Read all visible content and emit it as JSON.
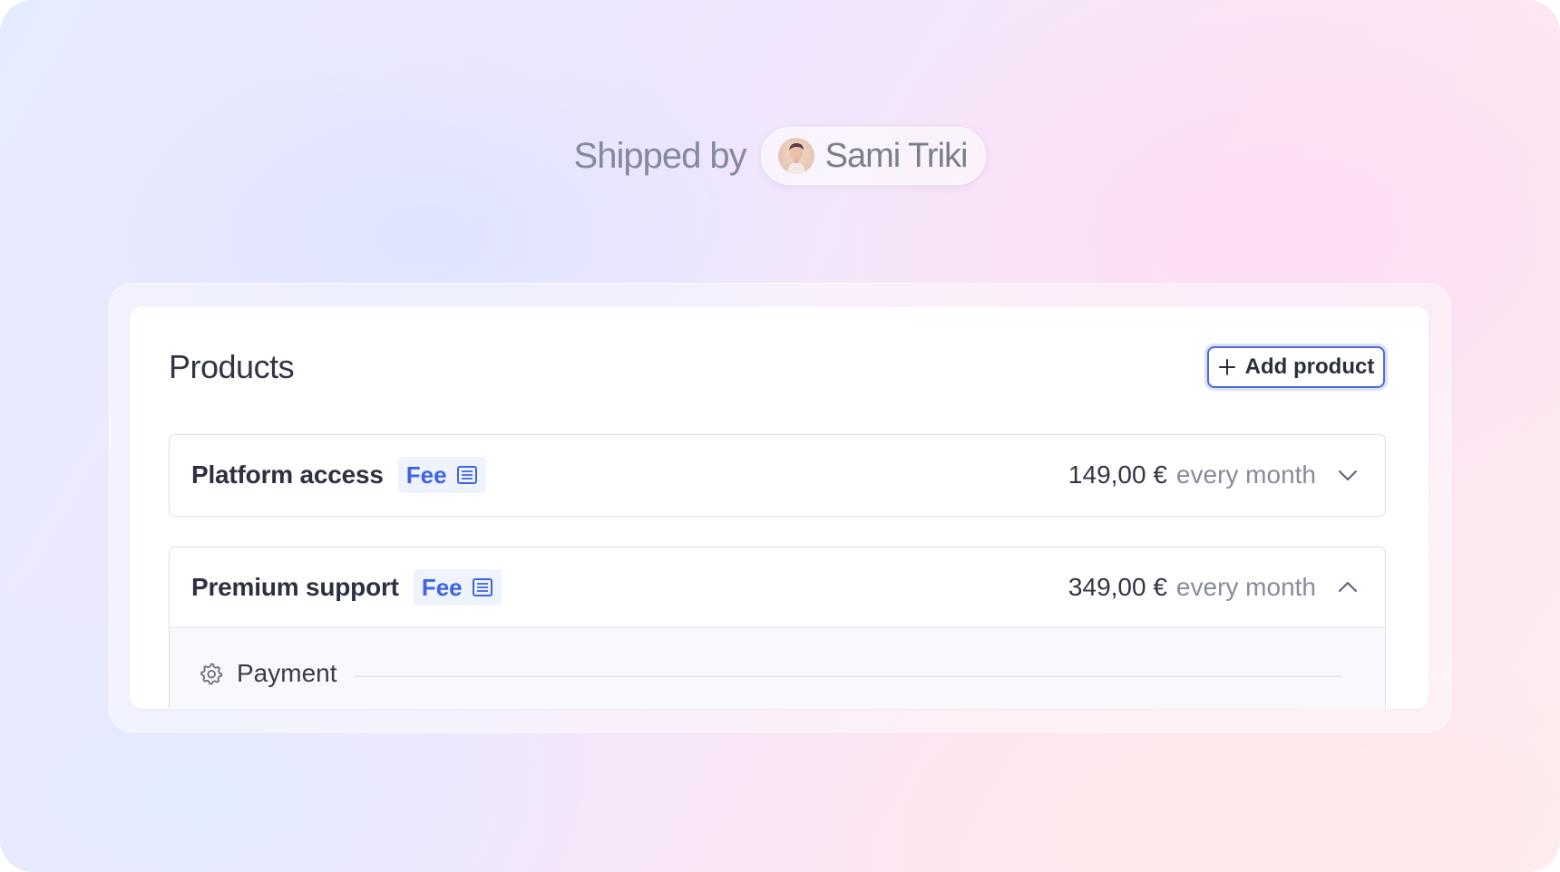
{
  "header": {
    "shipped_by": "Shipped by",
    "author_name": "Sami Triki"
  },
  "products": {
    "title": "Products",
    "add_button_label": "Add product",
    "items": [
      {
        "name": "Platform access",
        "badge": "Fee",
        "price": "149,00 €",
        "period": "every month",
        "expanded": false,
        "chevron": "chevron-down-icon"
      },
      {
        "name": "Premium support",
        "badge": "Fee",
        "price": "349,00 €",
        "period": "every month",
        "expanded": true,
        "chevron": "chevron-up-icon",
        "section_label": "Payment"
      }
    ]
  },
  "colors": {
    "accent": "#4d6ad8",
    "badge_text": "#3d63e6",
    "badge_bg": "#eff3fe"
  }
}
